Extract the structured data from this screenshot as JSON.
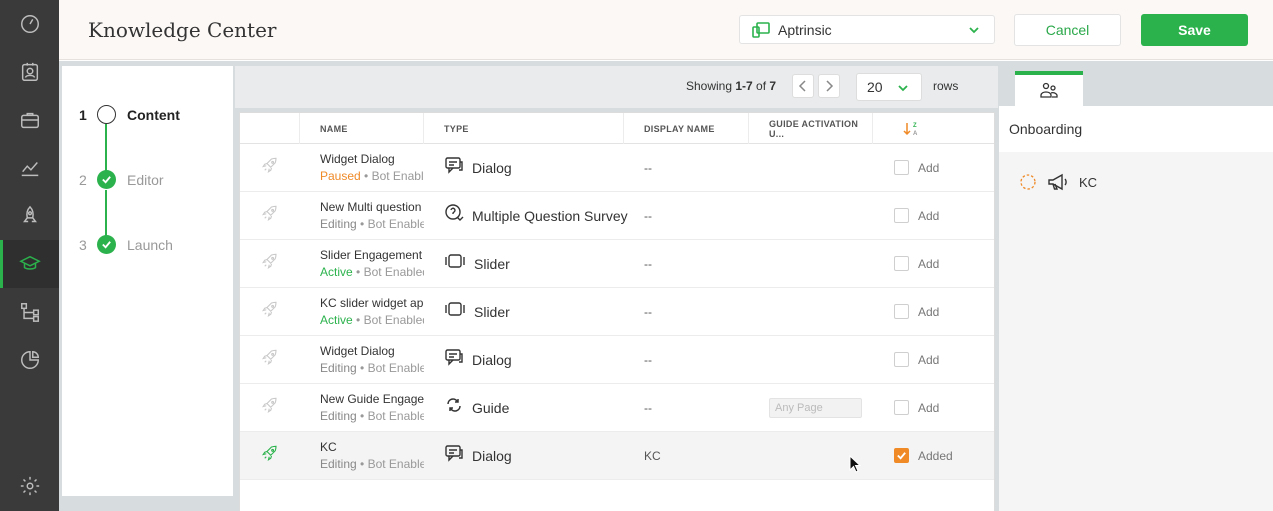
{
  "nav": {
    "items": [
      {
        "icon": "dashboard-icon"
      },
      {
        "icon": "contacts-icon"
      },
      {
        "icon": "briefcase-icon"
      },
      {
        "icon": "analytics-icon"
      },
      {
        "icon": "rocket-icon"
      },
      {
        "icon": "graduation-cap-icon",
        "active": true
      },
      {
        "icon": "hierarchy-icon"
      },
      {
        "icon": "pie-chart-icon"
      },
      {
        "icon": "gear-icon"
      }
    ],
    "accent": "#2bb24c"
  },
  "header": {
    "title": "Knowledge Center",
    "app_select": "Aptrinsic",
    "cancel_label": "Cancel",
    "save_label": "Save"
  },
  "steps": [
    {
      "num": "1",
      "label": "Content",
      "state": "current"
    },
    {
      "num": "2",
      "label": "Editor",
      "state": "done"
    },
    {
      "num": "3",
      "label": "Launch",
      "state": "done"
    }
  ],
  "toolbar": {
    "showing_prefix": "Showing ",
    "showing_range": "1-7",
    "showing_of": " of ",
    "showing_total": "7",
    "rows_value": "20",
    "rows_label": "rows"
  },
  "table": {
    "columns": [
      "NAME",
      "TYPE",
      "DISPLAY NAME",
      "GUIDE ACTIVATION U..."
    ],
    "rows": [
      {
        "name": "Widget Dialog",
        "status": "Paused",
        "status_kind": "paused",
        "meta": "Bot Enabled",
        "type": "Dialog",
        "type_icon": "dialog-icon",
        "display": "--",
        "activation": "",
        "add": "Add",
        "checked": false
      },
      {
        "name": "New Multi question",
        "status": "Editing",
        "status_kind": "editing",
        "meta": "Bot Enabled",
        "type": "Multiple Question Survey",
        "type_icon": "survey-icon",
        "display": "--",
        "activation": "",
        "add": "Add",
        "checked": false
      },
      {
        "name": "Slider Engagement",
        "status": "Active",
        "status_kind": "active",
        "meta": "Bot Enabled",
        "type": "Slider",
        "type_icon": "slider-icon",
        "display": "--",
        "activation": "",
        "add": "Add",
        "checked": false
      },
      {
        "name": "KC slider widget app",
        "status": "Active",
        "status_kind": "active",
        "meta": "Bot Enabled",
        "type": "Slider",
        "type_icon": "slider-icon",
        "display": "--",
        "activation": "",
        "add": "Add",
        "checked": false
      },
      {
        "name": "Widget Dialog",
        "status": "Editing",
        "status_kind": "editing",
        "meta": "Bot Enabled",
        "type": "Dialog",
        "type_icon": "dialog-icon",
        "display": "--",
        "activation": "",
        "add": "Add",
        "checked": false
      },
      {
        "name": "New Guide Engager",
        "status": "Editing",
        "status_kind": "editing",
        "meta": "Bot Enabled",
        "type": "Guide",
        "type_icon": "guide-icon",
        "display": "--",
        "activation": "Any Page",
        "add": "Add",
        "checked": false
      },
      {
        "name": "KC",
        "status": "Editing",
        "status_kind": "editing",
        "meta": "Bot Enabled",
        "type": "Dialog",
        "type_icon": "dialog-icon",
        "display": "KC",
        "activation": "",
        "add": "Added",
        "checked": true
      }
    ]
  },
  "right_panel": {
    "tab_icon": "users-icon",
    "header": "Onboarding",
    "item_label": "KC",
    "item_icon": "megaphone-icon"
  }
}
